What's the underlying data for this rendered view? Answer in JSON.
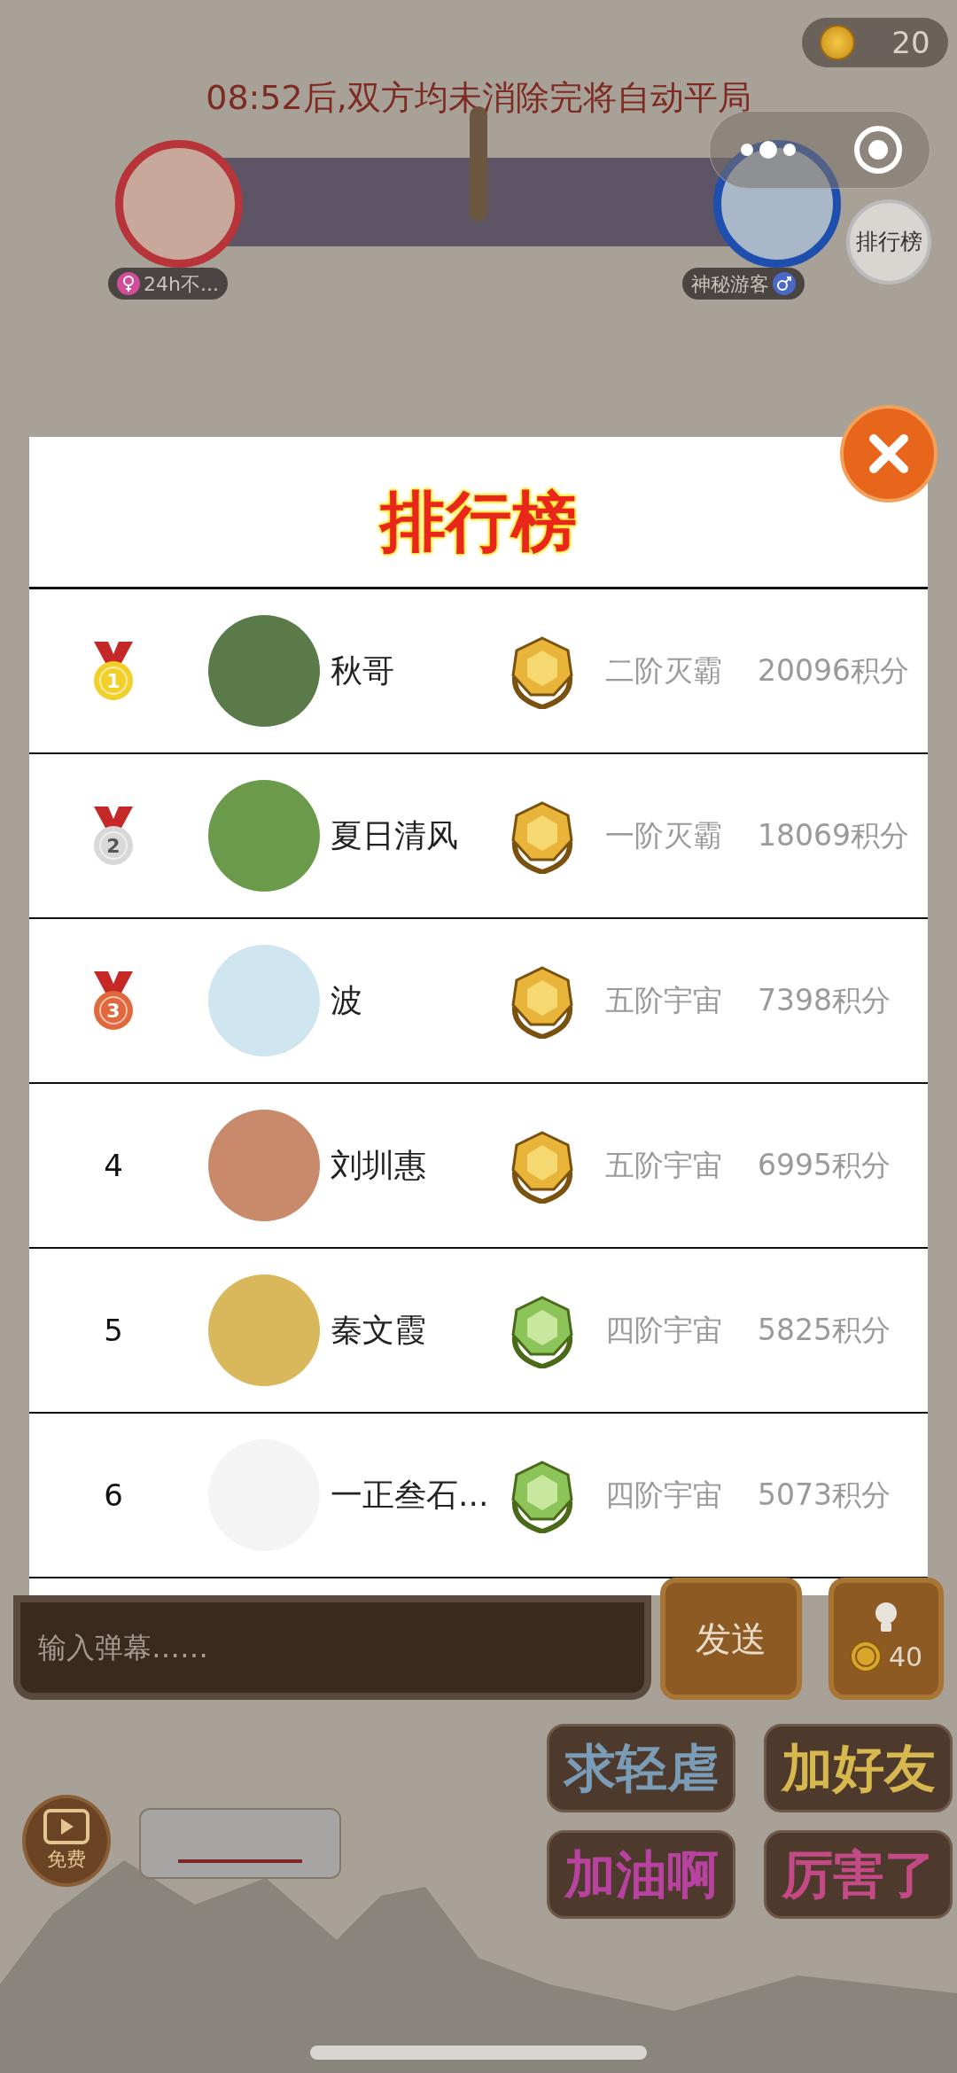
{
  "coins": "20",
  "timer": "08:52后,双方均未消除完将自动平局",
  "players": [
    {
      "name": "24h不...",
      "kind": "female"
    },
    {
      "name": "神秘游客",
      "kind": "male"
    }
  ],
  "leaderboard_button": "排行榜",
  "modal": {
    "title": "排行榜",
    "rows": [
      {
        "rank": "1",
        "kind": "gold",
        "name": "秋哥",
        "emblem": {
          "kind": "gold"
        },
        "tier": "二阶灭霸",
        "points": "20096积分"
      },
      {
        "rank": "2",
        "kind": "silver",
        "name": "夏日清风",
        "emblem": {
          "kind": "gold"
        },
        "tier": "一阶灭霸",
        "points": "18069积分"
      },
      {
        "rank": "3",
        "kind": "bronze",
        "name": "波",
        "emblem": {
          "kind": "gold"
        },
        "tier": "五阶宇宙",
        "points": "7398积分"
      },
      {
        "rank": "4",
        "kind": "plain",
        "name": "刘圳惠",
        "emblem": {
          "kind": "gold"
        },
        "tier": "五阶宇宙",
        "points": "6995积分"
      },
      {
        "rank": "5",
        "kind": "plain",
        "name": "秦文霞",
        "emblem": {
          "kind": "green"
        },
        "tier": "四阶宇宙",
        "points": "5825积分"
      },
      {
        "rank": "6",
        "kind": "plain",
        "name": "一正叁石...",
        "emblem": {
          "kind": "green"
        },
        "tier": "四阶宇宙",
        "points": "5073积分"
      }
    ]
  },
  "chat": {
    "placeholder": "输入弹幕……",
    "send": "发送",
    "hint_cost": "40"
  },
  "quick_phrases": [
    "求轻虐",
    "加好友",
    "加油啊",
    "厉害了"
  ],
  "free_button": "免费"
}
